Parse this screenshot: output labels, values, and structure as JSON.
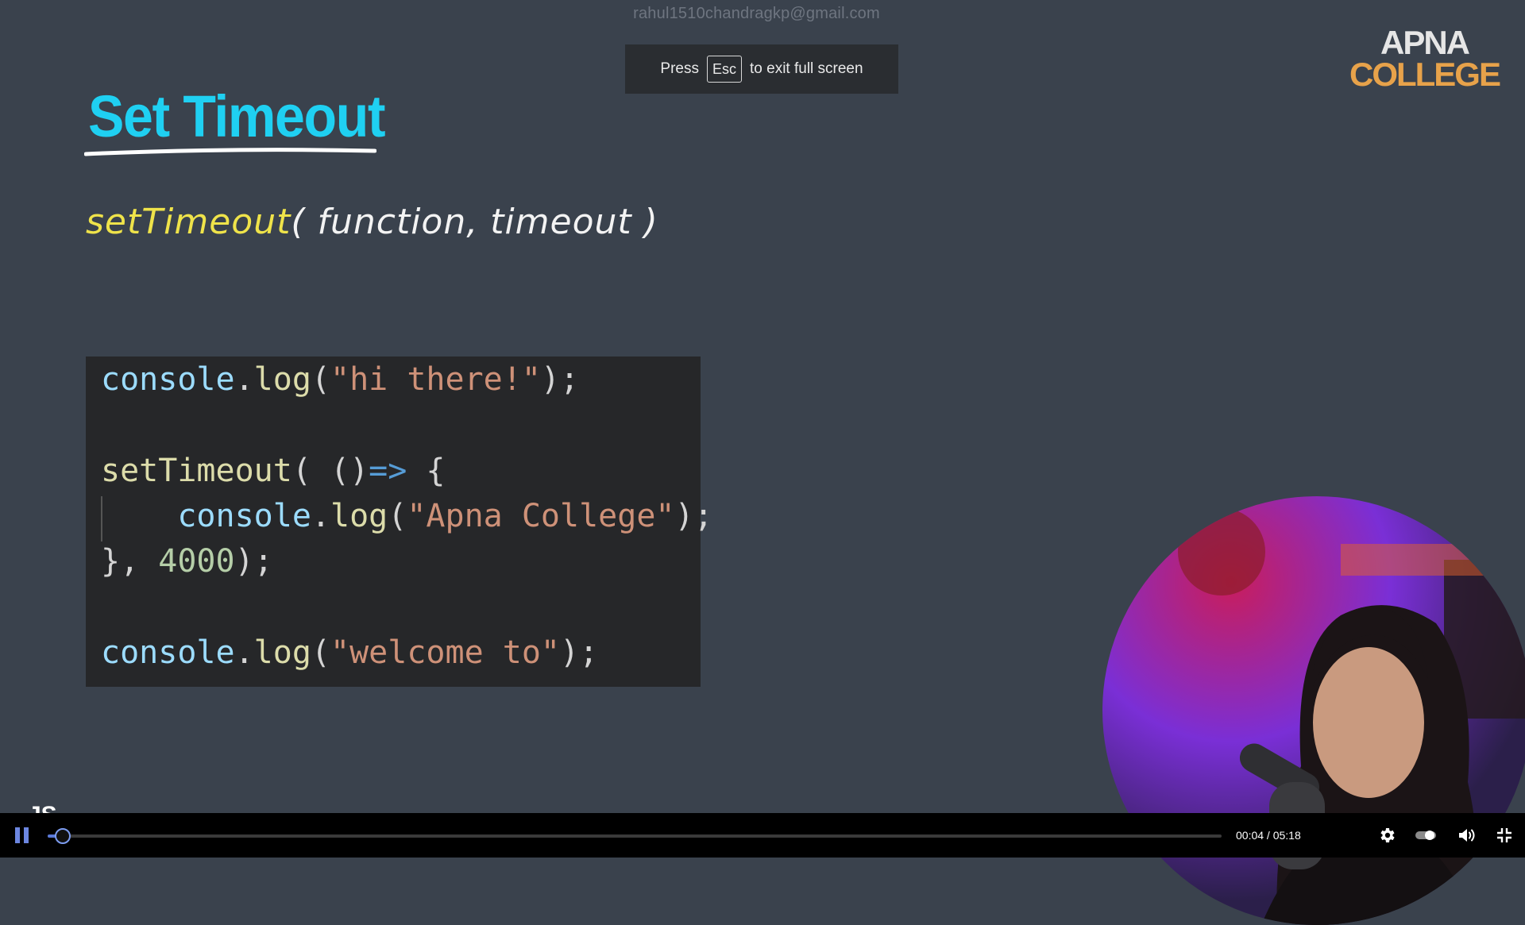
{
  "watermark": {
    "text": "rahul1510chandragkp@gmail.com"
  },
  "fullscreen_notice": {
    "before": "Press",
    "key": "Esc",
    "after": "to exit full screen"
  },
  "logo": {
    "top": "APNA",
    "bottom": "COLLEGE"
  },
  "slide": {
    "title": "Set Timeout",
    "signature_fn": "setTimeout",
    "signature_args": "( function, timeout )"
  },
  "code": {
    "l1": {
      "obj": "console",
      "dot": ".",
      "fn": "log",
      "open": "(",
      "str": "\"hi there!\"",
      "close": ");"
    },
    "l2": {
      "fn": "setTimeout",
      "open": "( ()",
      "arrow": "=>",
      "brace": " {"
    },
    "l3": {
      "indent": "    ",
      "obj": "console",
      "dot": ".",
      "fn": "log",
      "open": "(",
      "str": "\"Apna College\"",
      "close": ");"
    },
    "l4": {
      "brace": "}, ",
      "num": "4000",
      "close": ");"
    },
    "l5": {
      "obj": "console",
      "dot": ".",
      "fn": "log",
      "open": "(",
      "str": "\"welcome to\"",
      "close": ");"
    }
  },
  "slide_fragment": "JS",
  "player": {
    "progress": 0.0126,
    "current_time": "00:04",
    "duration": "05:18",
    "time_display": "00:04 / 05:18"
  },
  "icons": {
    "pause": "pause-icon",
    "settings": "gear-icon",
    "toggle": "toggle-icon",
    "volume": "volume-icon",
    "exit_fullscreen": "exit-fullscreen-icon"
  }
}
